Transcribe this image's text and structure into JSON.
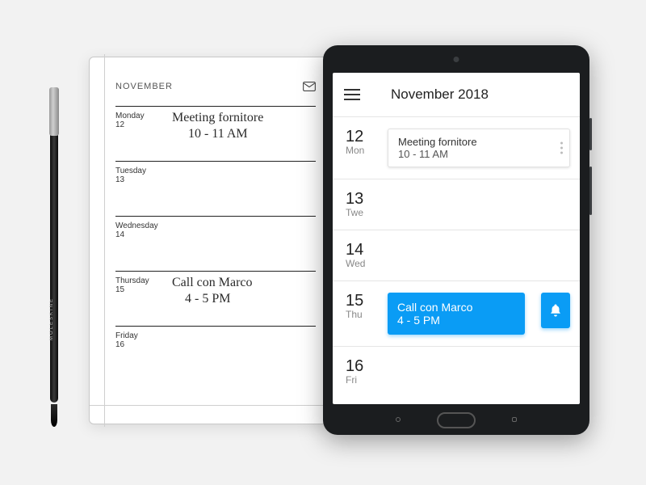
{
  "pen": {
    "brand": "MOLESKINE"
  },
  "notebook": {
    "month": "NOVEMBER",
    "days": [
      {
        "label": "Monday",
        "num": "12",
        "hand": "Meeting fornitore\n     10 - 11 AM"
      },
      {
        "label": "Tuesday",
        "num": "13",
        "hand": ""
      },
      {
        "label": "Wednesday",
        "num": "14",
        "hand": ""
      },
      {
        "label": "Thursday",
        "num": "15",
        "hand": "Call con Marco\n    4 - 5 PM"
      },
      {
        "label": "Friday",
        "num": "16",
        "hand": ""
      }
    ]
  },
  "app": {
    "title": "November 2018",
    "days": [
      {
        "num": "12",
        "dow": "Mon",
        "event": {
          "title": "Meeting fornitore",
          "time": "10 - 11 AM"
        }
      },
      {
        "num": "13",
        "dow": "Twe"
      },
      {
        "num": "14",
        "dow": "Wed"
      },
      {
        "num": "15",
        "dow": "Thu",
        "highlight": {
          "title": "Call con Marco",
          "time": "4 - 5 PM"
        }
      },
      {
        "num": "16",
        "dow": "Fri"
      }
    ]
  }
}
